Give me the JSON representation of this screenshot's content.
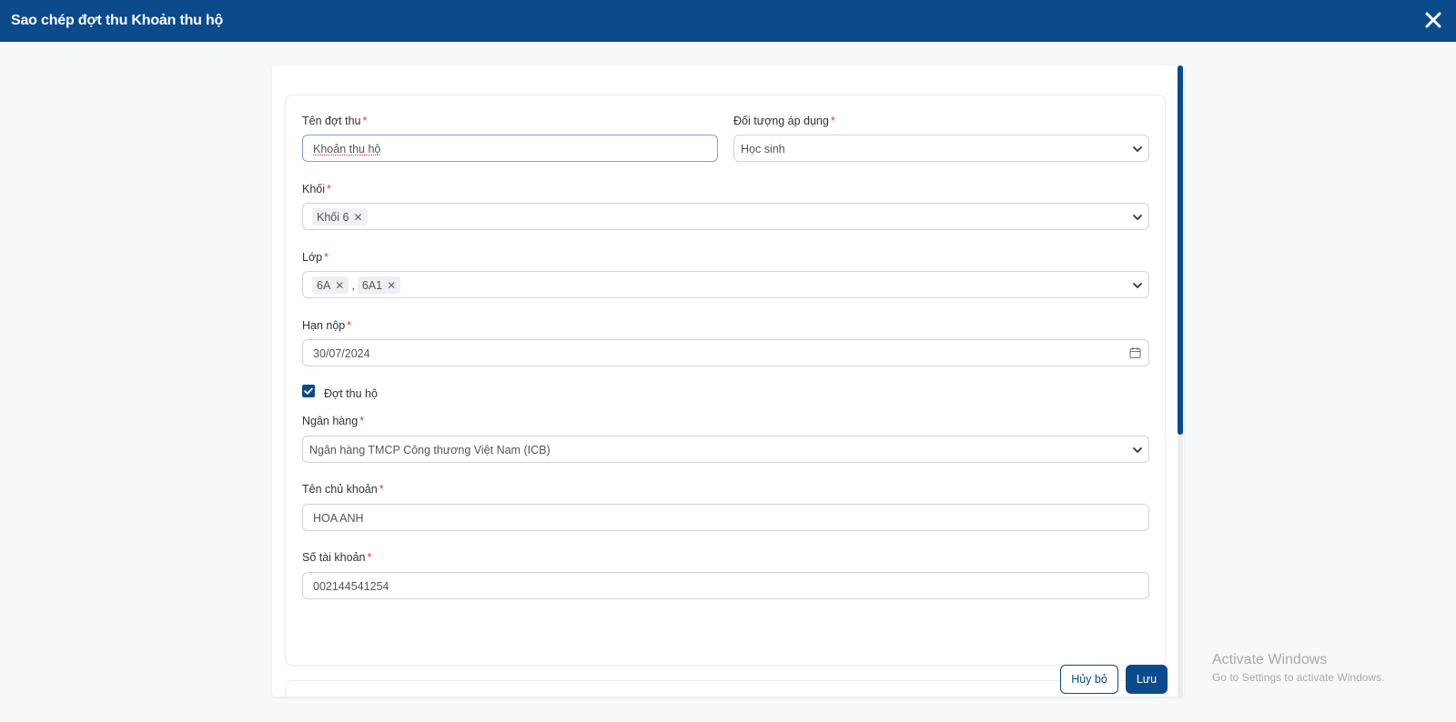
{
  "dialog": {
    "title": "Sao chép đợt thu Khoản thu hộ"
  },
  "form": {
    "campaign_name": {
      "label": "Tên đợt thu",
      "value": "Khoản thu hộ"
    },
    "applicable_target": {
      "label": "Đối tượng áp dụng",
      "value": "Học sinh"
    },
    "grade": {
      "label": "Khối",
      "tags": [
        "Khối 6"
      ]
    },
    "class": {
      "label": "Lớp",
      "tags": [
        "6A",
        "6A1"
      ],
      "separator": ","
    },
    "due_date": {
      "label": "Hạn nộp",
      "value": "30/07/2024"
    },
    "collection_on_behalf": {
      "label": "Đợt thu hộ",
      "checked": true
    },
    "bank": {
      "label": "Ngân hàng",
      "value": "Ngân hàng TMCP Công thương Việt Nam (ICB)"
    },
    "account_holder": {
      "label": "Tên chủ khoản",
      "value": "HOA ANH"
    },
    "account_number": {
      "label": "Số tài khoản",
      "value": "002144541254"
    },
    "required_marker": "*"
  },
  "footer": {
    "cancel_label": "Hủy bỏ",
    "save_label": "Lưu"
  },
  "watermark": {
    "line1": "Activate Windows",
    "line2": "Go to Settings to activate Windows."
  },
  "icons": {
    "close": "close-icon",
    "chevron": "chevron-down-icon",
    "calendar": "calendar-icon",
    "check": "check-icon",
    "remove_tag": "remove-tag-icon"
  },
  "colors": {
    "primary": "#0b4a8b",
    "required": "#e53935",
    "focus_border": "#7ea3e6"
  }
}
